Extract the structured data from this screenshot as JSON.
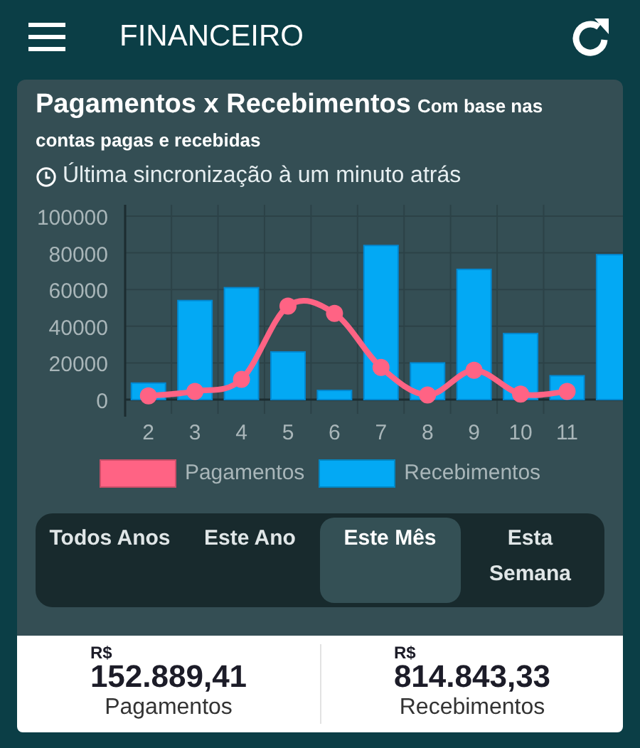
{
  "app_bar": {
    "title": "FINANCEIRO"
  },
  "card": {
    "title": "Pagamentos x Recebimentos",
    "subtitle": "Com base nas contas pagas e recebidas",
    "sync_text": "Última sincronização à um minuto atrás",
    "chart_data": {
      "type": "bar",
      "grid": true,
      "xlim": [
        1.5,
        12.2
      ],
      "x": [
        2,
        3,
        4,
        5,
        6,
        7,
        8,
        9,
        10,
        11,
        12
      ],
      "xticks": [
        2,
        3,
        4,
        5,
        6,
        7,
        8,
        9,
        10,
        11
      ],
      "yticks": [
        0,
        20000,
        40000,
        60000,
        80000,
        100000
      ],
      "ylim": [
        0,
        100000
      ],
      "series": [
        {
          "name": "Pagamentos",
          "color": "#ff6384",
          "type": "line",
          "marker": "circle",
          "values": [
            2000,
            4500,
            11000,
            51000,
            47000,
            17500,
            2500,
            16000,
            3000,
            4500,
            null
          ]
        },
        {
          "name": "Recebimentos",
          "color": "#03a9f4",
          "type": "bar",
          "values": [
            9000,
            54000,
            61000,
            26000,
            5000,
            84000,
            20000,
            71000,
            36000,
            13000,
            79000
          ]
        }
      ]
    }
  },
  "periods": [
    {
      "label": "Todos Anos",
      "selected": false
    },
    {
      "label": "Este Ano",
      "selected": false
    },
    {
      "label": "Este Mês",
      "selected": true
    },
    {
      "label": "Esta Semana",
      "selected": false
    }
  ],
  "totals": [
    {
      "currency": "R$",
      "amount": "152.889,41",
      "label": "Pagamentos"
    },
    {
      "currency": "R$",
      "amount": "814.843,33",
      "label": "Recebimentos"
    }
  ]
}
